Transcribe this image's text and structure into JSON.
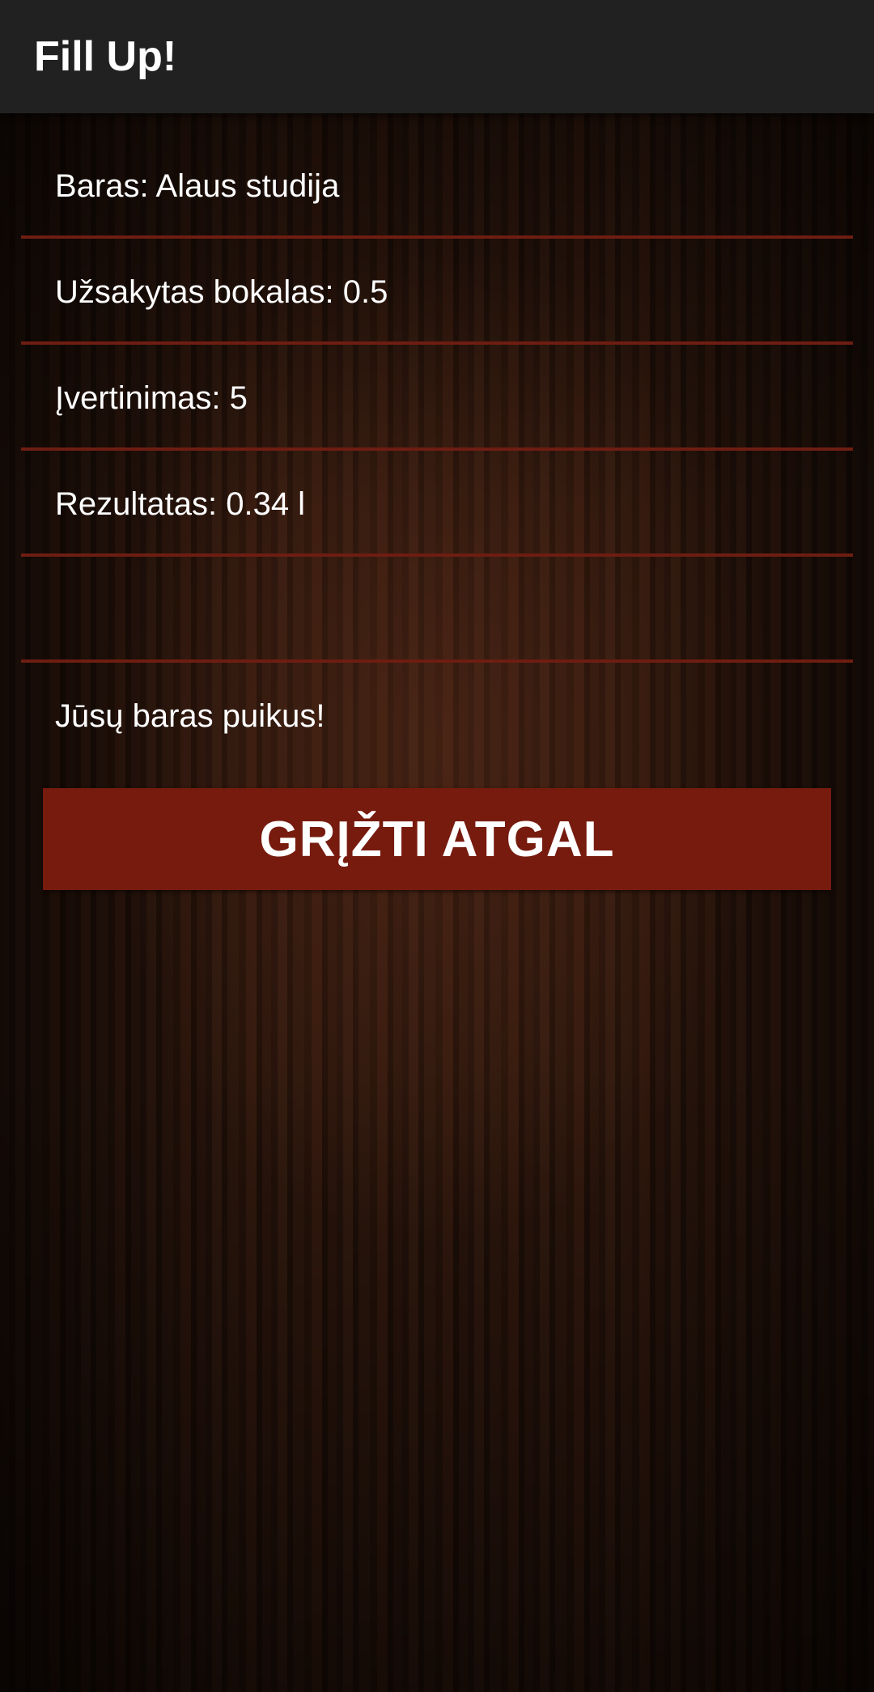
{
  "app_bar": {
    "title": "Fill Up!"
  },
  "details": {
    "bar": "Baras: Alaus studija",
    "ordered_glass": "Užsakytas bokalas: 0.5",
    "rating": "Įvertinimas: 5",
    "result": "Rezultatas: 0.34 l",
    "empty_row": ""
  },
  "message": "Jūsų baras puikus!",
  "back_button": {
    "label": "GRĮŽTI ATGAL"
  },
  "colors": {
    "app_bar": "#212121",
    "divider": "#6e1d12",
    "button": "#771b0f",
    "text": "#ffffff"
  }
}
